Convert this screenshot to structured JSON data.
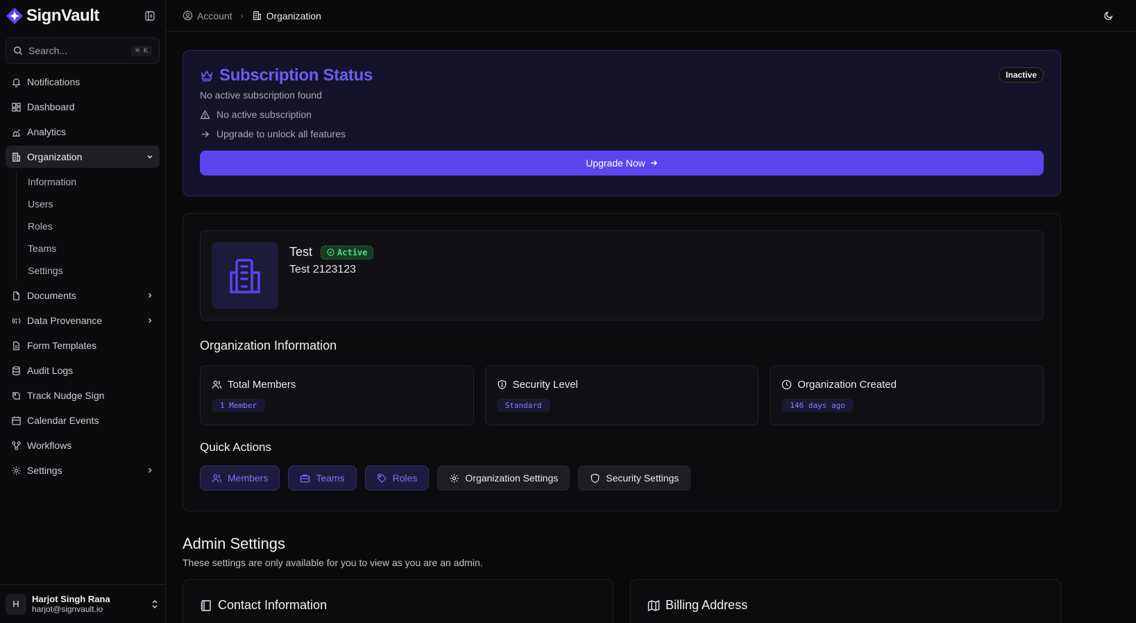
{
  "brand": {
    "name": "SignVault",
    "accent": "#5b45ee"
  },
  "search": {
    "placeholder": "Search...",
    "shortcut": "⌘ K"
  },
  "sidebar": {
    "items": [
      {
        "label": "Notifications",
        "icon": "bell-icon"
      },
      {
        "label": "Dashboard",
        "icon": "grid-icon"
      },
      {
        "label": "Analytics",
        "icon": "chart-icon"
      },
      {
        "label": "Organization",
        "icon": "building-icon",
        "expanded": true
      },
      {
        "label": "Documents",
        "icon": "file-icon"
      },
      {
        "label": "Data Provenance",
        "icon": "fingerprint-icon"
      },
      {
        "label": "Form Templates",
        "icon": "form-icon"
      },
      {
        "label": "Audit Logs",
        "icon": "database-icon"
      },
      {
        "label": "Track Nudge Sign",
        "icon": "signature-icon"
      },
      {
        "label": "Calendar Events",
        "icon": "calendar-icon"
      },
      {
        "label": "Workflows",
        "icon": "workflow-icon"
      },
      {
        "label": "Settings",
        "icon": "gear-icon"
      }
    ],
    "organization_sub": [
      "Information",
      "Users",
      "Roles",
      "Teams",
      "Settings"
    ]
  },
  "user": {
    "initial": "H",
    "name": "Harjot Singh Rana",
    "email": "harjot@signvault.io"
  },
  "breadcrumb": {
    "parent": "Account",
    "current": "Organization"
  },
  "subscription": {
    "title": "Subscription Status",
    "description": "No active subscription found",
    "status": "Inactive",
    "line1": "No active subscription",
    "line2": "Upgrade to unlock all features",
    "cta": "Upgrade Now"
  },
  "organization": {
    "name": "Test",
    "status": "Active",
    "subtitle": "Test 2123123",
    "info_title": "Organization Information",
    "stats": [
      {
        "label": "Total Members",
        "value": "1 Member",
        "icon": "users-icon"
      },
      {
        "label": "Security Level",
        "value": "Standard",
        "icon": "shield-icon"
      },
      {
        "label": "Organization Created",
        "value": "146 days ago",
        "icon": "clock-icon"
      }
    ],
    "quick_actions_title": "Quick Actions",
    "quick_actions": [
      {
        "label": "Members",
        "icon": "users-icon",
        "style": "primary"
      },
      {
        "label": "Teams",
        "icon": "briefcase-icon",
        "style": "primary"
      },
      {
        "label": "Roles",
        "icon": "tag-icon",
        "style": "primary"
      },
      {
        "label": "Organization Settings",
        "icon": "gear-icon",
        "style": "secondary"
      },
      {
        "label": "Security Settings",
        "icon": "shield-icon",
        "style": "secondary"
      }
    ]
  },
  "admin": {
    "title": "Admin Settings",
    "description": "These settings are only available for you to view as you are an admin.",
    "contact_title": "Contact Information",
    "billing_title": "Billing Address"
  }
}
